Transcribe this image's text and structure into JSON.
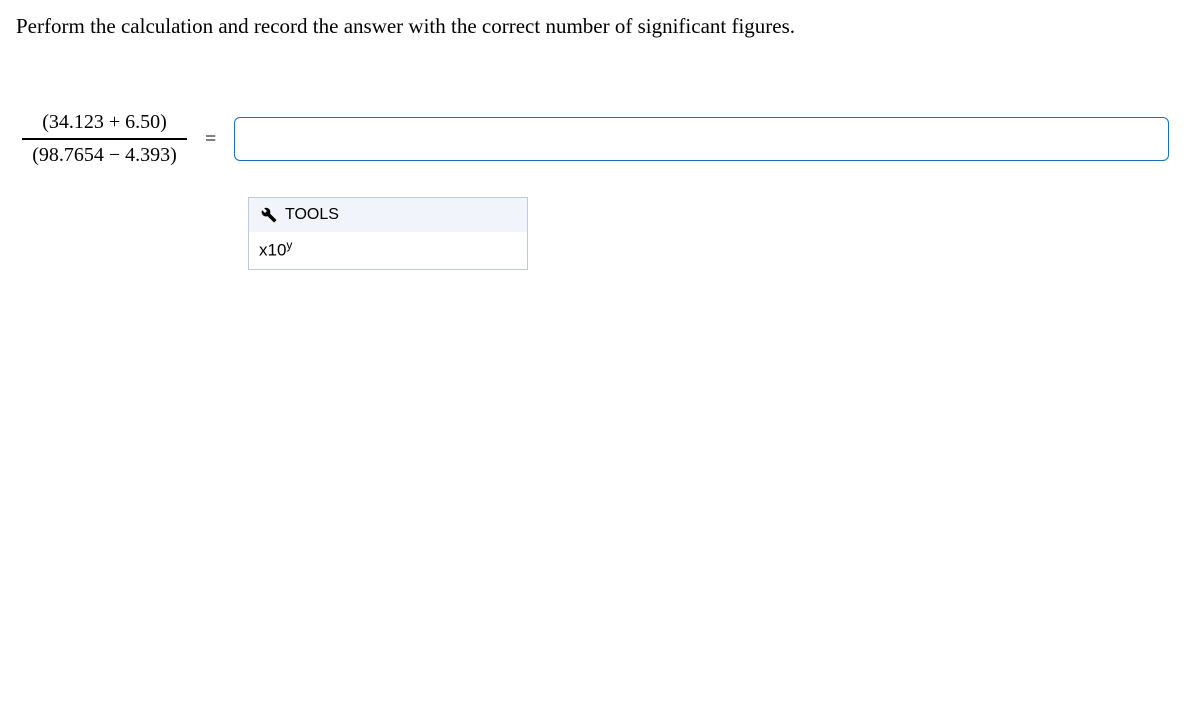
{
  "question": {
    "prompt": "Perform the calculation and record the answer with the correct number of significant figures."
  },
  "equation": {
    "numerator": "(34.123 + 6.50)",
    "denominator": "(98.7654 − 4.393)",
    "equals": "="
  },
  "answer": {
    "value": ""
  },
  "tools": {
    "header": "TOOLS",
    "icon_name": "wrench-icon",
    "items": {
      "sci_notation_base": "x10",
      "sci_notation_exp": "y"
    }
  },
  "fraction_line_height": "1.5px"
}
